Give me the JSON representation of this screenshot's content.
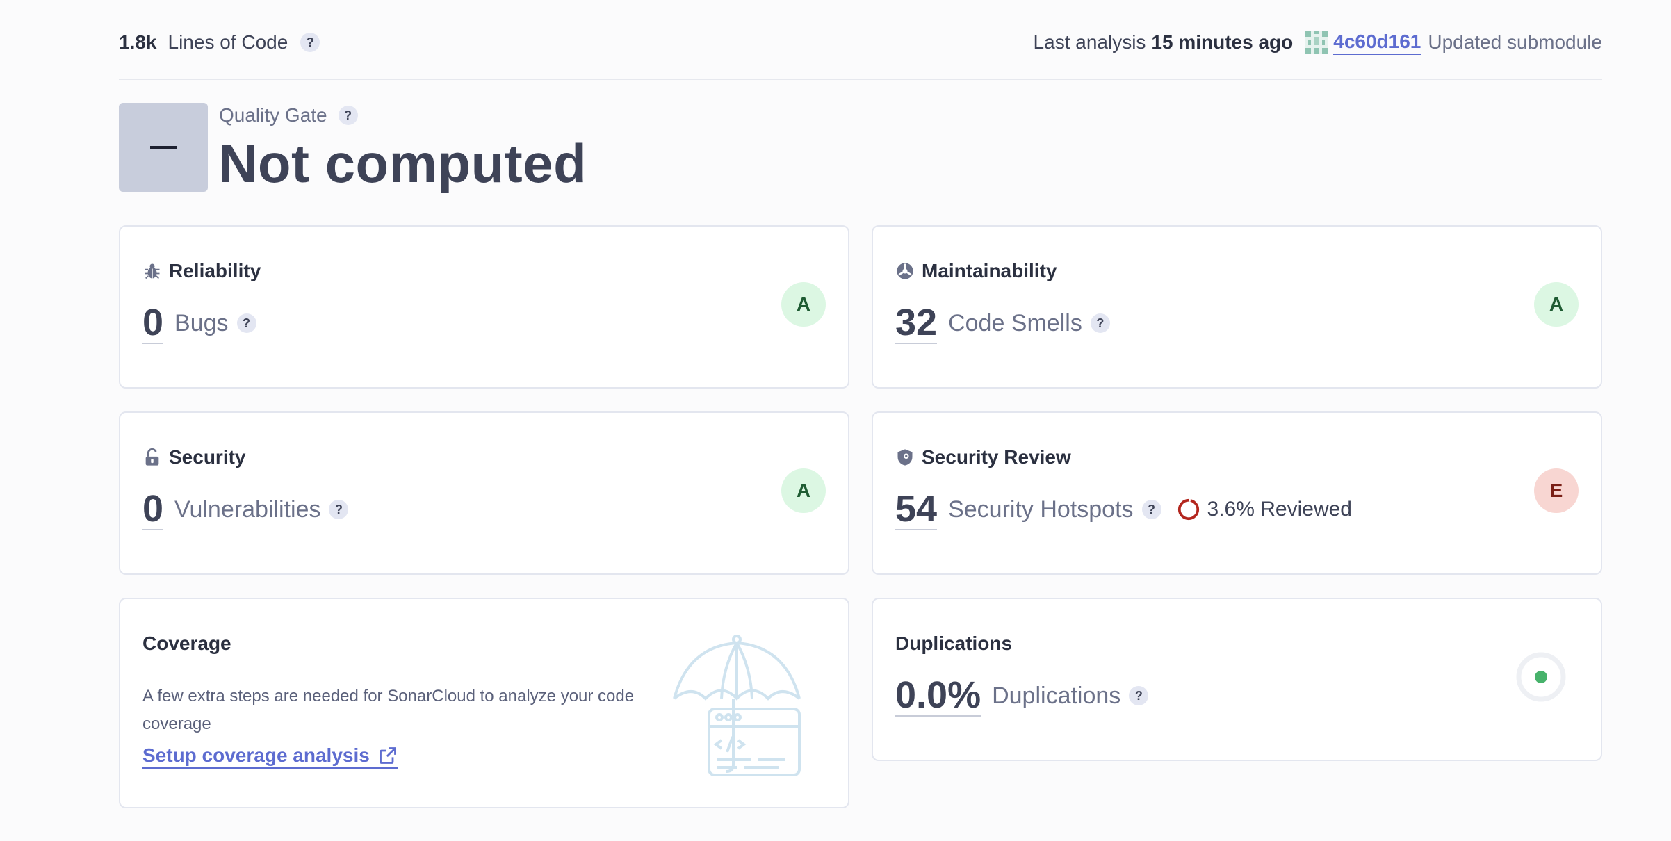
{
  "header": {
    "loc_value": "1.8k",
    "loc_label": "Lines of Code",
    "help": "?",
    "last_analysis_label": "Last analysis",
    "last_analysis_time": "15 minutes ago",
    "commit_hash": "4c60d161",
    "commit_message": "Updated submodule"
  },
  "quality_gate": {
    "title": "Quality Gate",
    "status": "Not computed"
  },
  "cards": {
    "reliability": {
      "title": "Reliability",
      "value": "0",
      "label": "Bugs",
      "rating": "A",
      "icon": "bug-icon"
    },
    "maintainability": {
      "title": "Maintainability",
      "value": "32",
      "label": "Code Smells",
      "rating": "A",
      "icon": "maintainability-icon"
    },
    "security": {
      "title": "Security",
      "value": "0",
      "label": "Vulnerabilities",
      "rating": "A",
      "icon": "lock-open-icon"
    },
    "security_review": {
      "title": "Security Review",
      "value": "54",
      "label": "Security Hotspots",
      "rating": "E",
      "reviewed": "3.6% Reviewed",
      "reviewed_fraction": 0.036,
      "icon": "shield-icon"
    },
    "coverage": {
      "title": "Coverage",
      "description": "A few extra steps are needed for SonarCloud to analyze your code coverage",
      "link": "Setup coverage analysis",
      "icon": "external-link-icon"
    },
    "duplications": {
      "title": "Duplications",
      "value": "0.0%",
      "label": "Duplications"
    }
  },
  "colors": {
    "accent": "#5d6cd0",
    "rating_a_bg": "#dcf7e3",
    "rating_e_bg": "#f8d6d2",
    "hotspot_ring": "#b3261e",
    "duplication_dot": "#47b26b"
  }
}
